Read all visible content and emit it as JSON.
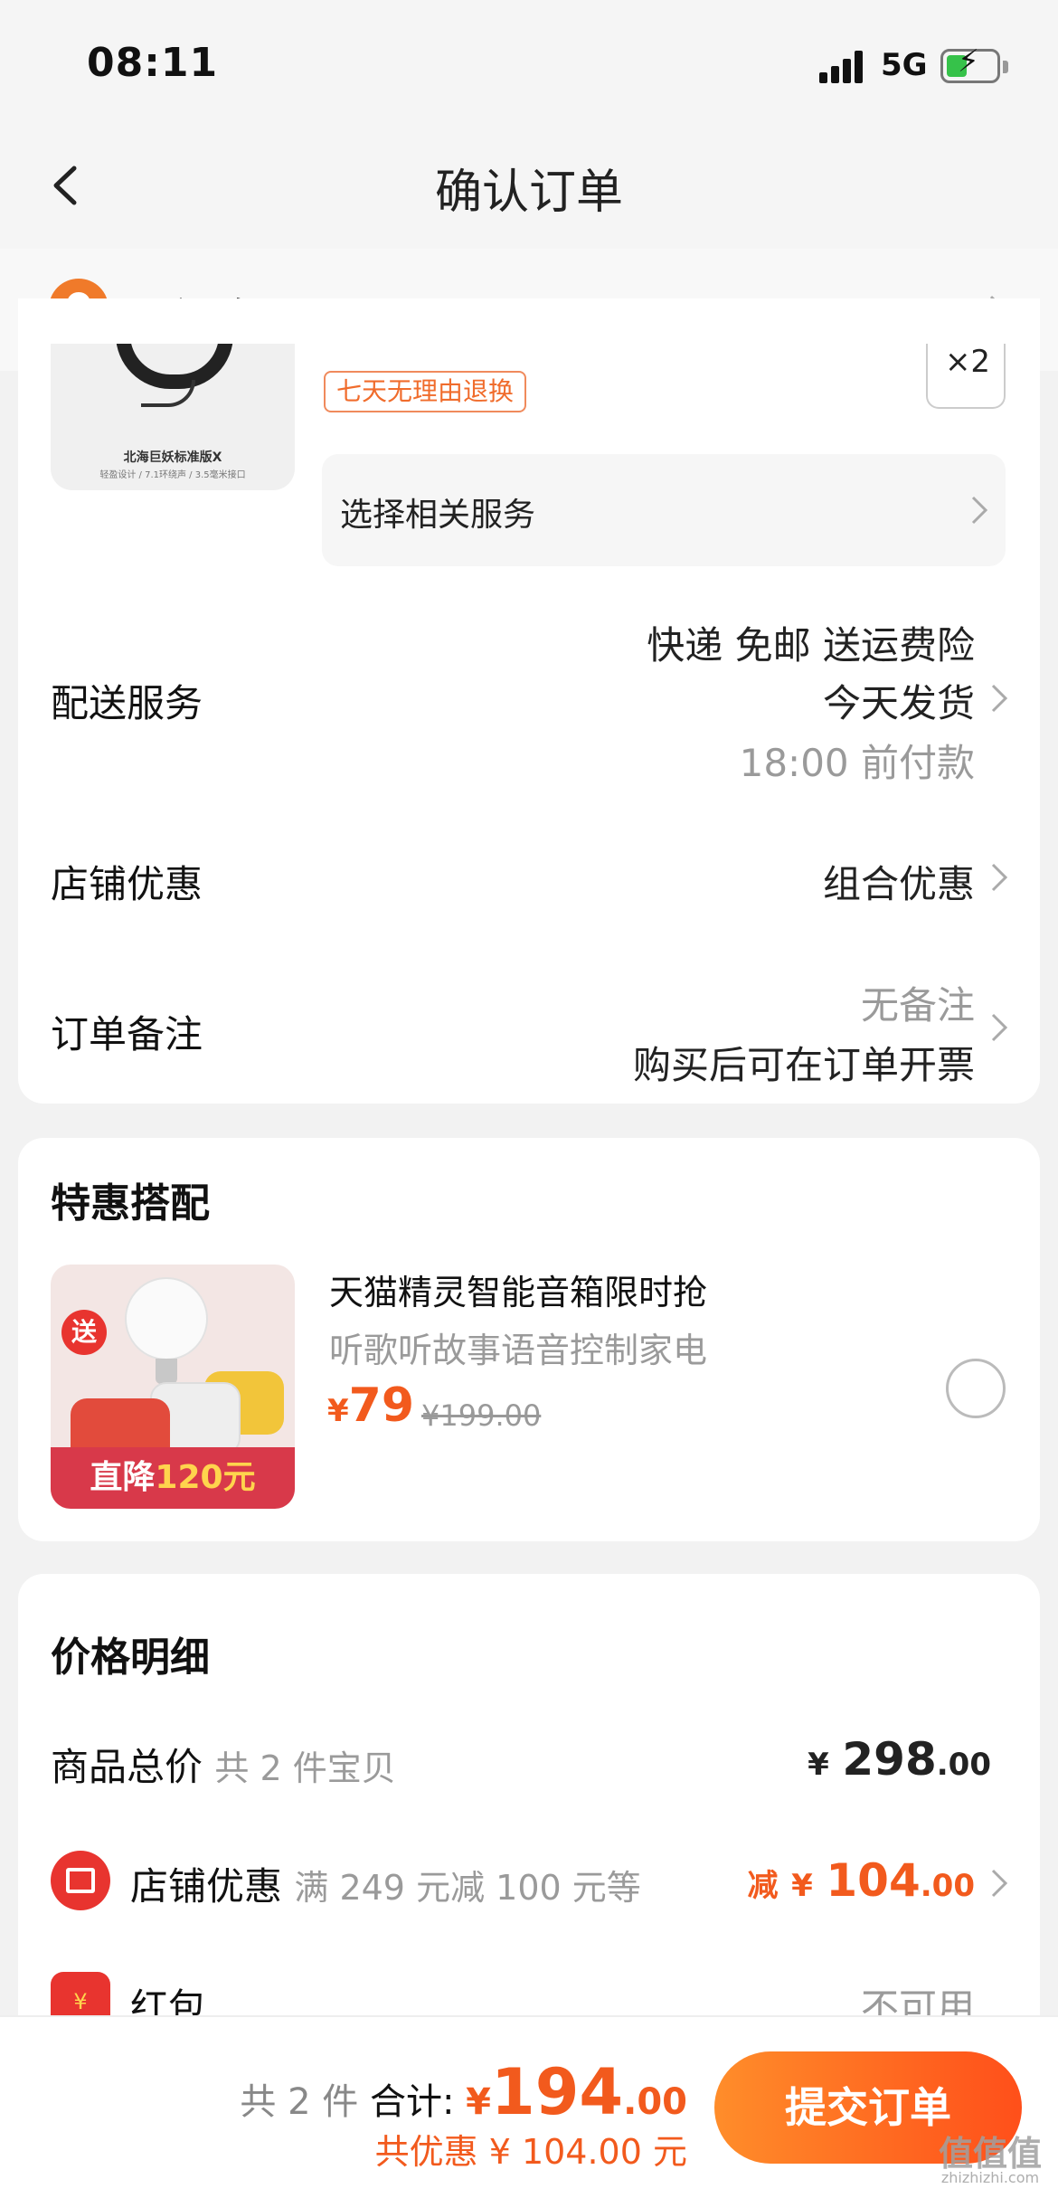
{
  "status_bar": {
    "time": "08:11",
    "network": "5G"
  },
  "nav": {
    "title": "确认订单"
  },
  "address": {
    "text": "西门路"
  },
  "product": {
    "thumb_title": "北海巨妖标准版X",
    "thumb_sub": "轻盈设计 / 7.1环绕声 / 3.5毫米接口",
    "return_tag": "七天无理由退换",
    "quantity": "×2",
    "service_label": "选择相关服务"
  },
  "delivery": {
    "label": "配送服务",
    "line1": "快递 免邮 送运费险",
    "line2": "今天发货",
    "line3": "18:00 前付款"
  },
  "shop_discount_row": {
    "label": "店铺优惠",
    "value": "组合优惠"
  },
  "order_note": {
    "label": "订单备注",
    "value": "无备注",
    "invoice": "购买后可在订单开票"
  },
  "promo": {
    "section_title": "特惠搭配",
    "badge": "送",
    "banner_prefix": "直降",
    "banner_highlight": "120元",
    "title": "天猫精灵智能音箱限时抢",
    "subtitle": "听歌听故事语音控制家电",
    "price_symbol": "¥",
    "price": "79",
    "original_price": "¥199.00"
  },
  "price_detail": {
    "section_title": "价格明细",
    "goods_label": "商品总价",
    "goods_count": "共 2 件宝贝",
    "goods_symbol": "¥",
    "goods_int": "298",
    "goods_dec": ".00",
    "shop_label": "店铺优惠",
    "shop_desc": "满 249 元减 100 元等",
    "shop_prefix": "减",
    "shop_symbol": "¥",
    "shop_int": "104",
    "shop_dec": ".00",
    "redbag_icon": "¥",
    "redbag_label": "红包",
    "redbag_value": "不可用"
  },
  "bottom": {
    "count": "共 2 件",
    "total_label": "合计:",
    "total_symbol": "¥",
    "total_int": "194",
    "total_dec": ".00",
    "discount": "共优惠 ¥ 104.00 元",
    "submit": "提交订单"
  },
  "watermark": {
    "text": "值值值",
    "url": "zhizhizhi.com"
  },
  "colors": {
    "accent": "#f25a1d",
    "pin": "#f07a2a",
    "badge_red": "#e8342f"
  },
  "icons": [
    "back-icon",
    "location-pin-icon",
    "chevron-right-icon",
    "shop-icon",
    "red-envelope-icon",
    "radio-unchecked-icon",
    "signal-icon",
    "battery-charging-icon"
  ]
}
